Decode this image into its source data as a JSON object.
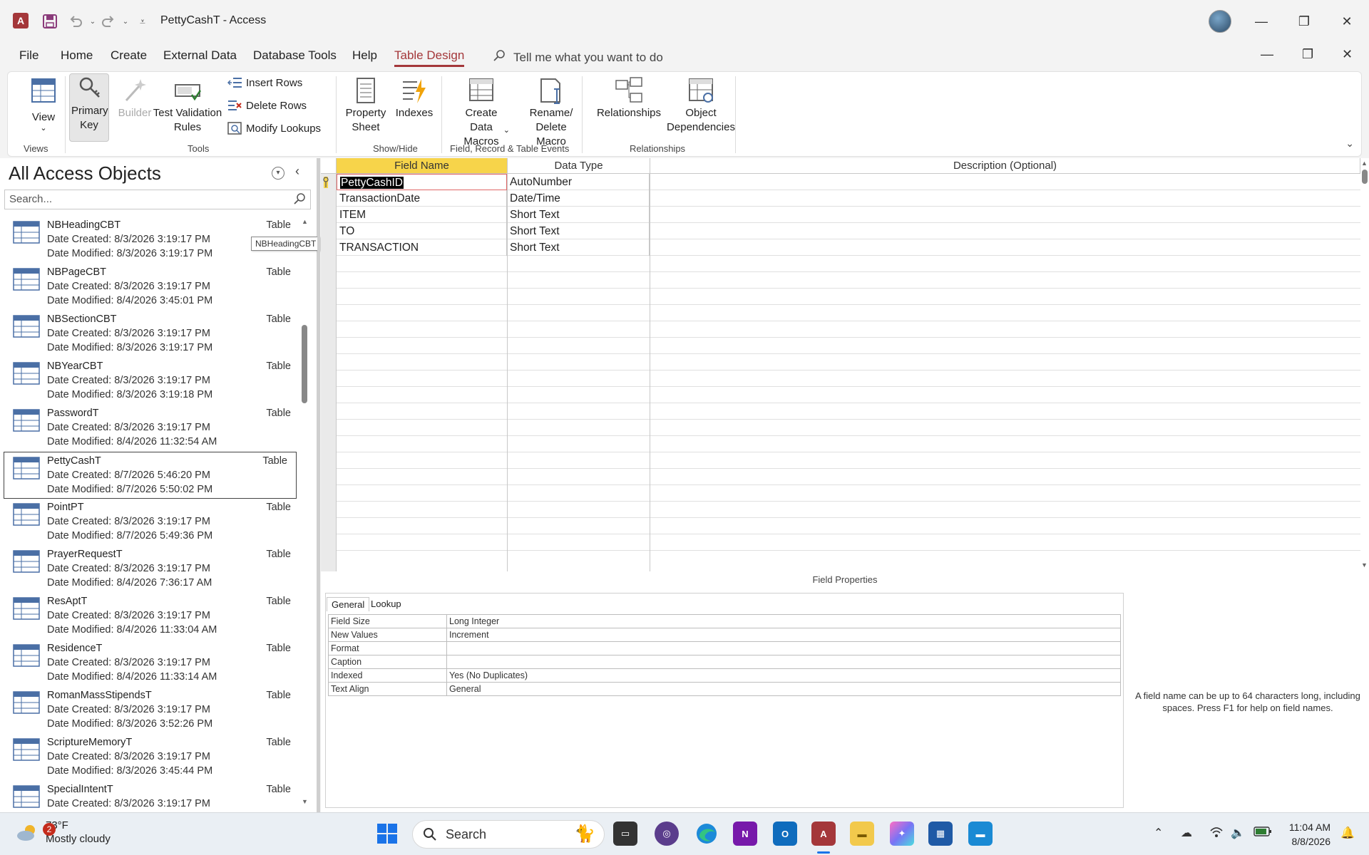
{
  "window": {
    "title": "PettyCashT  -  Access",
    "app_icon_letter": "A",
    "quick_access": {
      "save": "save-icon",
      "undo": "undo-icon",
      "redo": "redo-icon",
      "customize": "customize-icon"
    }
  },
  "menu": {
    "items": [
      "File",
      "Home",
      "Create",
      "External Data",
      "Database Tools",
      "Help",
      "Table Design"
    ],
    "active": "Table Design",
    "tell_me": "Tell me what you want to do"
  },
  "ribbon": {
    "views": {
      "view_label": "View",
      "group": "Views"
    },
    "tools": {
      "primary_key": "Primary Key",
      "builder": "Builder",
      "test_validation": "Test Validation Rules",
      "insert_rows": "Insert Rows",
      "delete_rows": "Delete Rows",
      "modify_lookups": "Modify Lookups",
      "group": "Tools"
    },
    "showhide": {
      "property_sheet": "Property Sheet",
      "indexes": "Indexes",
      "group": "Show/Hide"
    },
    "events": {
      "create_data_macros": "Create Data Macros",
      "rename_delete_macro": "Rename/ Delete Macro",
      "group": "Field, Record & Table Events"
    },
    "relationships": {
      "relationships": "Relationships",
      "object_dependencies": "Object Dependencies",
      "group": "Relationships"
    }
  },
  "nav_pane": {
    "title": "All Access Objects",
    "search_placeholder": "Search...",
    "tooltip": "NBHeadingCBT",
    "entries": [
      {
        "name": "NBHeadingCBT",
        "type": "Table",
        "created": "Date Created: 8/3/2026 3:19:17 PM",
        "modified": "Date Modified: 8/3/2026 3:19:17 PM"
      },
      {
        "name": "NBPageCBT",
        "type": "Table",
        "created": "Date Created: 8/3/2026 3:19:17 PM",
        "modified": "Date Modified: 8/4/2026 3:45:01 PM"
      },
      {
        "name": "NBSectionCBT",
        "type": "Table",
        "created": "Date Created: 8/3/2026 3:19:17 PM",
        "modified": "Date Modified: 8/3/2026 3:19:17 PM"
      },
      {
        "name": "NBYearCBT",
        "type": "Table",
        "created": "Date Created: 8/3/2026 3:19:17 PM",
        "modified": "Date Modified: 8/3/2026 3:19:18 PM"
      },
      {
        "name": "PasswordT",
        "type": "Table",
        "created": "Date Created: 8/3/2026 3:19:17 PM",
        "modified": "Date Modified: 8/4/2026 11:32:54 AM"
      },
      {
        "name": "PettyCashT",
        "type": "Table",
        "created": "Date Created: 8/7/2026 5:46:20 PM",
        "modified": "Date Modified: 8/7/2026 5:50:02 PM"
      },
      {
        "name": "PointPT",
        "type": "Table",
        "created": "Date Created: 8/3/2026 3:19:17 PM",
        "modified": "Date Modified: 8/7/2026 5:49:36 PM"
      },
      {
        "name": "PrayerRequestT",
        "type": "Table",
        "created": "Date Created: 8/3/2026 3:19:17 PM",
        "modified": "Date Modified: 8/4/2026 7:36:17 AM"
      },
      {
        "name": "ResAptT",
        "type": "Table",
        "created": "Date Created: 8/3/2026 3:19:17 PM",
        "modified": "Date Modified: 8/4/2026 11:33:04 AM"
      },
      {
        "name": "ResidenceT",
        "type": "Table",
        "created": "Date Created: 8/3/2026 3:19:17 PM",
        "modified": "Date Modified: 8/4/2026 11:33:14 AM"
      },
      {
        "name": "RomanMassStipendsT",
        "type": "Table",
        "created": "Date Created: 8/3/2026 3:19:17 PM",
        "modified": "Date Modified: 8/3/2026 3:52:26 PM"
      },
      {
        "name": "ScriptureMemoryT",
        "type": "Table",
        "created": "Date Created: 8/3/2026 3:19:17 PM",
        "modified": "Date Modified: 8/3/2026 3:45:44 PM"
      },
      {
        "name": "SpecialIntentT",
        "type": "Table",
        "created": "Date Created: 8/3/2026 3:19:17 PM",
        "modified": ""
      }
    ]
  },
  "design_grid": {
    "headers": {
      "field_name": "Field Name",
      "data_type": "Data Type",
      "description": "Description (Optional)"
    },
    "rows": [
      {
        "field": "PettyCashID",
        "type": "AutoNumber"
      },
      {
        "field": "TransactionDate",
        "type": "Date/Time"
      },
      {
        "field": "ITEM",
        "type": "Short Text"
      },
      {
        "field": "TO",
        "type": "Short Text"
      },
      {
        "field": "TRANSACTION",
        "type": "Short Text"
      }
    ]
  },
  "field_properties": {
    "title": "Field Properties",
    "tabs": [
      "General",
      "Lookup"
    ],
    "rows": [
      {
        "key": "Field Size",
        "value": "Long Integer"
      },
      {
        "key": "New Values",
        "value": "Increment"
      },
      {
        "key": "Format",
        "value": ""
      },
      {
        "key": "Caption",
        "value": ""
      },
      {
        "key": "Indexed",
        "value": "Yes (No Duplicates)"
      },
      {
        "key": "Text Align",
        "value": "General"
      }
    ],
    "help": "A field name can be up to 64 characters long, including spaces. Press F1 for help on field names."
  },
  "taskbar": {
    "weather_temp": "73°F",
    "weather_desc": "Mostly cloudy",
    "weather_badge": "2",
    "search": "Search",
    "time": "11:04 AM",
    "date": "8/8/2026"
  },
  "colors": {
    "accent": "#a4373a",
    "taskbar": "#eaeff4"
  }
}
